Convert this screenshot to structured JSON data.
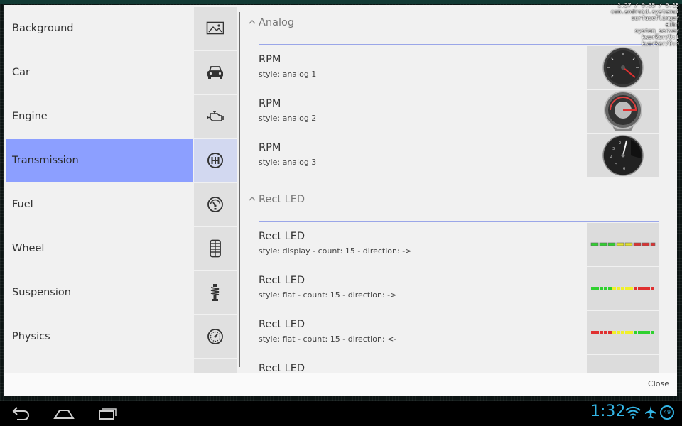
{
  "categories": [
    {
      "label": "Background",
      "icon": "image-icon"
    },
    {
      "label": "Car",
      "icon": "car-icon"
    },
    {
      "label": "Engine",
      "icon": "engine-icon"
    },
    {
      "label": "Transmission",
      "icon": "gearshift-icon",
      "selected": true
    },
    {
      "label": "Fuel",
      "icon": "fuel-gauge-icon"
    },
    {
      "label": "Wheel",
      "icon": "tire-icon"
    },
    {
      "label": "Suspension",
      "icon": "suspension-icon"
    },
    {
      "label": "Physics",
      "icon": "speedometer-icon"
    }
  ],
  "sections": [
    {
      "title": "Analog",
      "items": [
        {
          "title": "RPM",
          "subtitle": "style: analog 1"
        },
        {
          "title": "RPM",
          "subtitle": "style: analog 2"
        },
        {
          "title": "RPM",
          "subtitle": "style: analog 3"
        }
      ]
    },
    {
      "title": "Rect LED",
      "items": [
        {
          "title": "Rect LED",
          "subtitle": "style: display - count: 15 - direction: ->"
        },
        {
          "title": "Rect LED",
          "subtitle": "style: flat - count: 15 - direction: ->"
        },
        {
          "title": "Rect LED",
          "subtitle": "style: flat - count: 15 - direction: <-"
        },
        {
          "title": "Rect LED",
          "subtitle": ""
        }
      ]
    }
  ],
  "footer": {
    "close_label": "Close"
  },
  "debug_overlay": [
    "1.27 / 0.35 / 0.15",
    "com.android.systemui",
    "surfaceflinger",
    "adbd",
    "system_server",
    "kworker/0:1",
    "kworker/0:0"
  ],
  "status": {
    "time": "1:32",
    "battery": "49"
  },
  "colors": {
    "selected_row": "#8c9fff",
    "section_line": "#9aa6e8",
    "clock": "#33b5e5",
    "led_green": "#2fd12f",
    "led_yellow": "#f0f02a",
    "led_red": "#e03030"
  }
}
